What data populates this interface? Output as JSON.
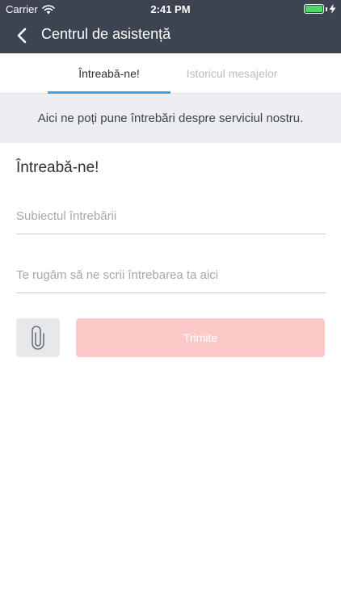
{
  "status_bar": {
    "carrier": "Carrier",
    "time": "2:41 PM"
  },
  "nav": {
    "title": "Centrul de asistență",
    "back_icon": "chevron-left-icon"
  },
  "tabs": [
    {
      "label": "Întreabă-ne!",
      "active": true
    },
    {
      "label": "Istoricul mesajelor",
      "active": false
    }
  ],
  "banner": {
    "text": "Aici ne poți pune întrebări despre serviciul nostru."
  },
  "form": {
    "title": "Întreabă-ne!",
    "subject_placeholder": "Subiectul întrebării",
    "subject_value": "",
    "question_placeholder": "Te rugăm să ne scrii întrebarea ta aici",
    "question_value": "",
    "attach_icon": "paperclip-icon",
    "send_label": "Trimite"
  },
  "colors": {
    "header_bg": "#3c4452",
    "tab_accent": "#3ba9dc",
    "send_button_bg": "#fdc8c8",
    "banner_bg": "#eceef1",
    "battery": "#4cd964"
  }
}
